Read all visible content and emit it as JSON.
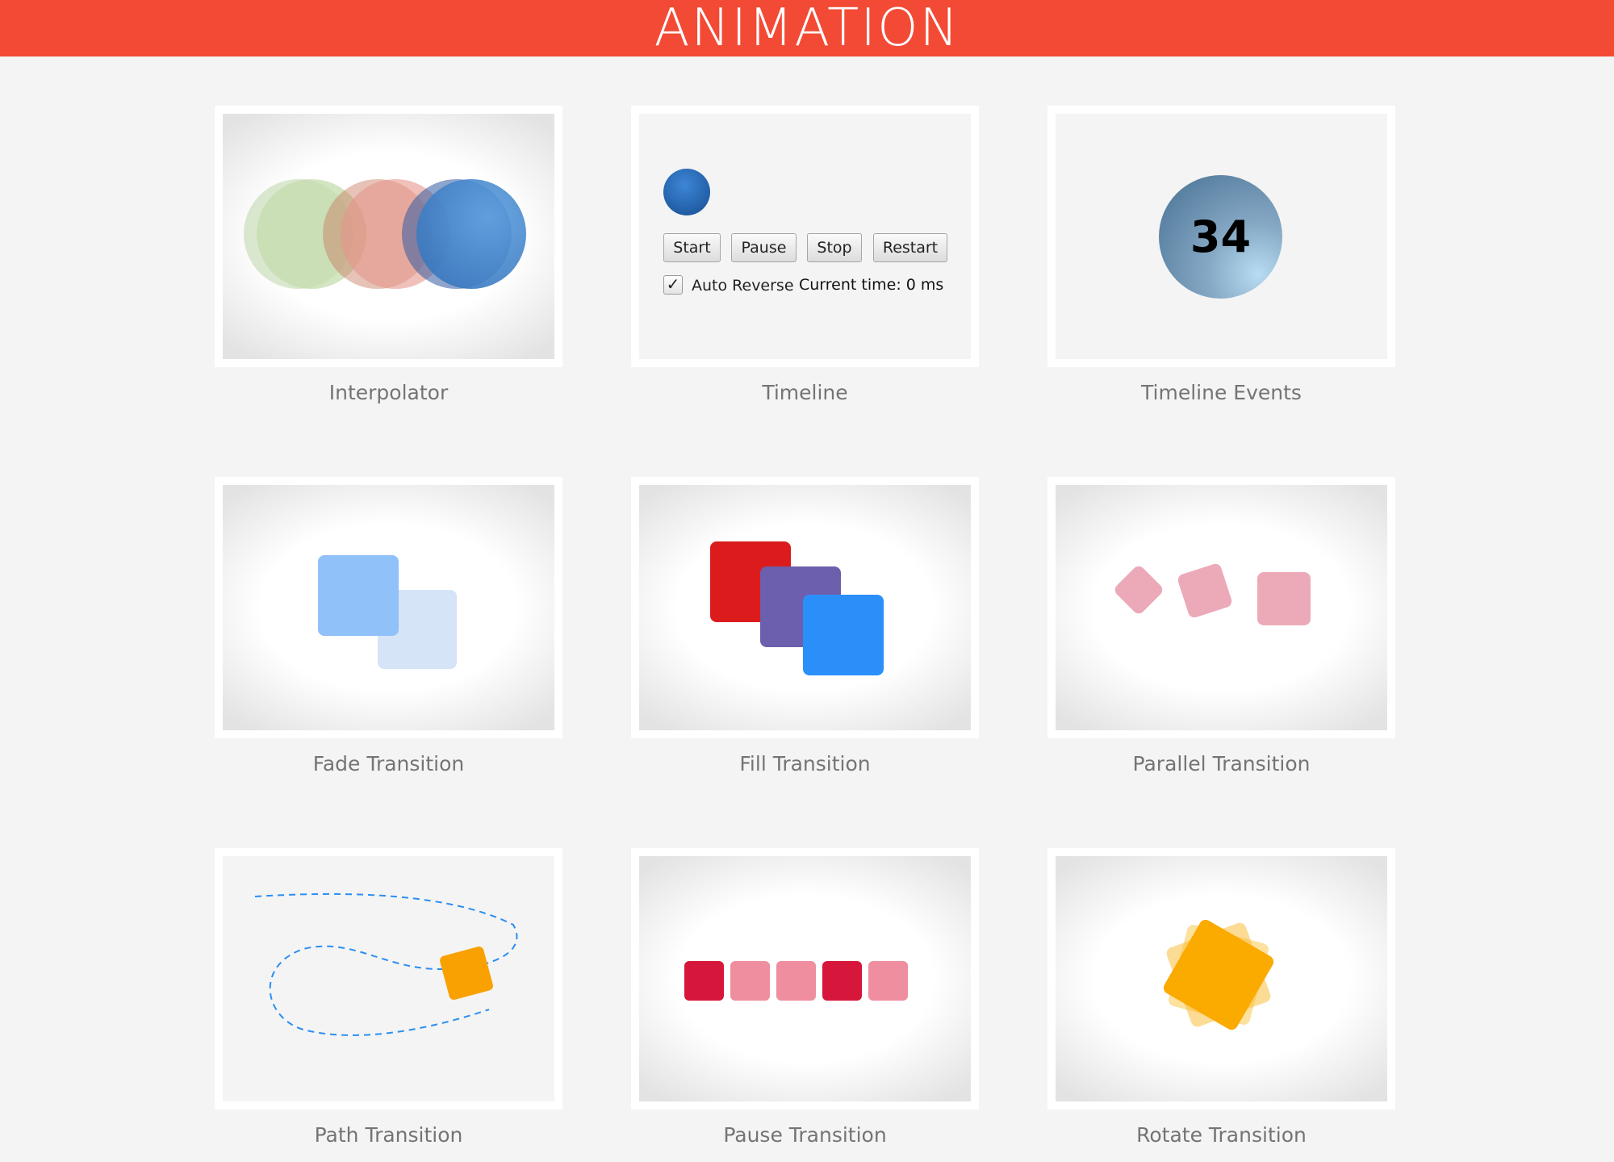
{
  "header": {
    "title": "ANIMATION"
  },
  "cards": [
    {
      "label": "Interpolator"
    },
    {
      "label": "Timeline"
    },
    {
      "label": "Timeline Events"
    },
    {
      "label": "Fade Transition"
    },
    {
      "label": "Fill Transition"
    },
    {
      "label": "Parallel Transition"
    },
    {
      "label": "Path Transition"
    },
    {
      "label": "Pause Transition"
    },
    {
      "label": "Rotate Transition"
    }
  ],
  "timeline": {
    "buttons": [
      "Start",
      "Pause",
      "Stop",
      "Restart"
    ],
    "checkbox_label": "Auto Reverse",
    "checkbox_checked": true,
    "checkmark": "✓",
    "current_time_label": "Current time: 0 ms"
  },
  "timeline_events": {
    "counter": "34"
  },
  "colors": {
    "header": "#f34a35",
    "background": "#f4f4f4",
    "caption": "#747474"
  }
}
